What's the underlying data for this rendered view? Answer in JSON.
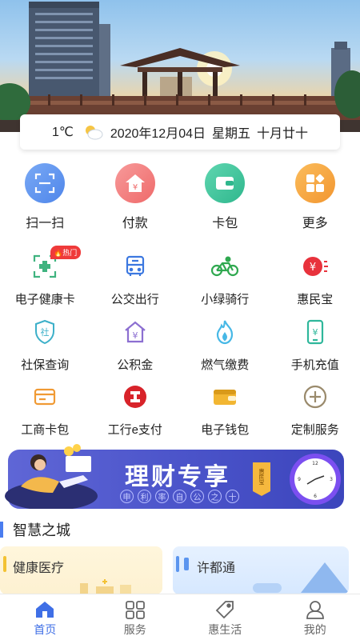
{
  "colors": {
    "accent": "#3f6fe6",
    "badge": "#ef3a3a",
    "promo": "#4a53c9"
  },
  "weather": {
    "temperature": "1℃",
    "icon": "partly-cloudy-icon",
    "date": "2020年12月04日",
    "weekday": "星期五",
    "lunar": "十月廿十"
  },
  "quick_actions": [
    {
      "label": "扫一扫",
      "icon": "scan-icon",
      "color": "#5b95ef"
    },
    {
      "label": "付款",
      "icon": "payment-icon",
      "color": "#f27373"
    },
    {
      "label": "卡包",
      "icon": "card-wallet-icon",
      "color": "#38c39a"
    },
    {
      "label": "更多",
      "icon": "more-icon",
      "color": "#f6a23f"
    }
  ],
  "services": [
    [
      {
        "label": "电子健康卡",
        "icon": "health-card-icon",
        "badge": "热门"
      },
      {
        "label": "公交出行",
        "icon": "bus-icon"
      },
      {
        "label": "小绿骑行",
        "icon": "bike-icon"
      },
      {
        "label": "惠民宝",
        "icon": "yen-coin-icon"
      }
    ],
    [
      {
        "label": "社保查询",
        "icon": "social-security-shield-icon"
      },
      {
        "label": "公积金",
        "icon": "housing-fund-icon"
      },
      {
        "label": "燃气缴费",
        "icon": "flame-icon"
      },
      {
        "label": "手机充值",
        "icon": "phone-recharge-icon"
      }
    ],
    [
      {
        "label": "工商卡包",
        "icon": "icbc-card-icon"
      },
      {
        "label": "工行e支付",
        "icon": "icbc-logo-icon"
      },
      {
        "label": "电子钱包",
        "icon": "wallet-icon"
      },
      {
        "label": "定制服务",
        "icon": "plus-circle-icon"
      }
    ]
  ],
  "promo": {
    "title": "理财专享",
    "chips": [
      "申",
      "利",
      "率",
      "自",
      "公",
      "之",
      "十"
    ],
    "tag": "惠民宝"
  },
  "section": {
    "title": "智慧之城"
  },
  "cards": [
    {
      "title": "健康医疗",
      "color": "#f3c233"
    },
    {
      "title": "许都通",
      "color": "#5b95ef"
    }
  ],
  "tabs": [
    {
      "label": "首页",
      "icon": "home-icon",
      "active": true
    },
    {
      "label": "服务",
      "icon": "services-grid-icon",
      "active": false
    },
    {
      "label": "惠生活",
      "icon": "price-tag-icon",
      "active": false
    },
    {
      "label": "我的",
      "icon": "user-icon",
      "active": false
    }
  ]
}
